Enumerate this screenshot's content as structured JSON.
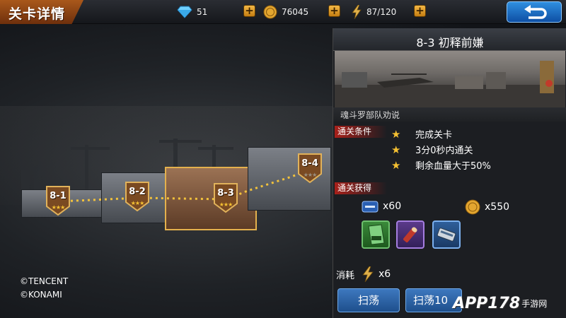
{
  "header": {
    "title": "关卡详情",
    "diamonds": "51",
    "gold": "76045",
    "stamina": "87/120",
    "plus_label": "+"
  },
  "stages": [
    {
      "label": "8-1",
      "stars": "★★★",
      "selected": false
    },
    {
      "label": "8-2",
      "stars": "★★★",
      "selected": false
    },
    {
      "label": "8-3",
      "stars": "★★★",
      "selected": true
    },
    {
      "label": "8-4",
      "stars": "★★★",
      "selected": false
    }
  ],
  "copyright": {
    "line1": "©TENCENT",
    "line2": "©KONAMI"
  },
  "panel": {
    "stage_title": "8-3 初释前嫌",
    "boss_line": "魂斗罗部队劝说",
    "conditions_tag": "通关条件",
    "conditions": [
      "完成关卡",
      "3分0秒内通关",
      "剩余血量大于50%"
    ],
    "rewards_tag": "通关获得",
    "exp_reward": "x60",
    "gold_reward": "x550",
    "cost_label": "消耗",
    "cost_value": "x6",
    "sweep_label": "扫荡",
    "sweep10_label": "扫荡10"
  },
  "watermark": {
    "main": "APP178",
    "sub": "手游网"
  },
  "colors": {
    "accent_orange": "#a9581b",
    "selected_border": "#e4b14d",
    "tag_red": "#a8201a",
    "button_blue": "#2f72c0",
    "star_gold": "#f5c132"
  }
}
